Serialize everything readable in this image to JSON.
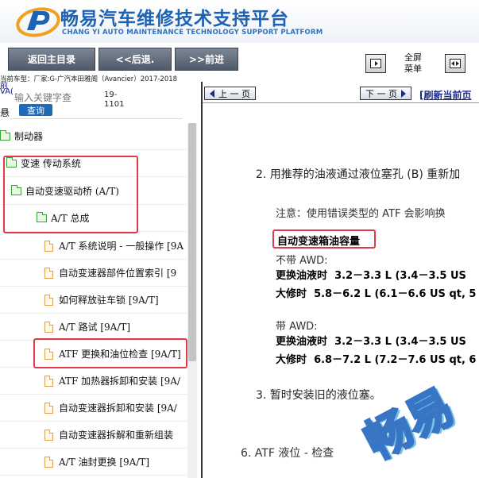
{
  "header": {
    "title_zh": "畅易汽车维修技术支持平台",
    "title_en": "CHANG YI AUTO MAINTENANCE TECHNOLOGY SUPPORT PLATFORM"
  },
  "toolbar": {
    "home_label": "返回主目录",
    "back_label": "<<后退.",
    "forward_label": ">>前进",
    "fullscreen_label_1": "全屏",
    "fullscreen_label_2": "菜单"
  },
  "vehicle_info": "当前车型：厂家:G-广汽本田雅阁（Avancier）2017-2018",
  "left": {
    "edge_1": "前",
    "edge_2": "VA(",
    "search_placeholder": "输入关键字查",
    "search_button": "查询",
    "code": "19-\n1101",
    "edge_item": "悬",
    "tree": [
      {
        "label": "制动器",
        "icon": "folder"
      },
      {
        "label": "变速 传动系统",
        "icon": "folder"
      },
      {
        "label": "自动变速驱动桥 (A/T)",
        "icon": "folder-open"
      },
      {
        "label": "A/T 总成",
        "icon": "folder-open"
      },
      {
        "label": "A/T 系统说明 - 一般操作 [9A",
        "icon": "doc"
      },
      {
        "label": "自动变速器部件位置索引 [9",
        "icon": "doc"
      },
      {
        "label": "如何释放驻车锁 [9A/T]",
        "icon": "doc"
      },
      {
        "label": "A/T 路试 [9A/T]",
        "icon": "doc"
      },
      {
        "label": "ATF 更换和油位检查 [9A/T]",
        "icon": "doc"
      },
      {
        "label": "ATF 加热器拆卸和安装 [9A/",
        "icon": "doc"
      },
      {
        "label": "自动变速器拆卸和安装 [9A/",
        "icon": "doc"
      },
      {
        "label": "自动变速器拆解和重新组装",
        "icon": "doc"
      },
      {
        "label": "A/T 油封更换 [9A/T]",
        "icon": "doc"
      }
    ]
  },
  "right": {
    "prev_page": "上 一 页",
    "next_page": "下 一 页",
    "refresh": "[刷新当前页",
    "doc": {
      "step2": "2.  用推荐的油液通过液位塞孔 (B) 重新加",
      "note": "注意：使用错误类型的 ATF 会影响换",
      "capacity_heading": "自动变速箱油容量",
      "no_awd": "不带 AWD:",
      "no_awd_change_label": "更换油液时",
      "no_awd_change_value": "3.2－3.3 L (3.4－3.5 US",
      "no_awd_overhaul_label": "大修时",
      "no_awd_overhaul_value": "5.8－6.2 L (6.1－6.6 US qt, 5",
      "with_awd": "带 AWD:",
      "awd_change_label": "更换油液时",
      "awd_change_value": "3.2－3.3 L (3.4－3.5 US",
      "awd_overhaul_label": "大修时",
      "awd_overhaul_value": "6.8－7.2 L (7.2－7.6 US qt, 6",
      "step3": "3.  暂时安装旧的液位塞。",
      "section6": "6. ATF 液位 - 检查",
      "watermark": "畅易"
    }
  },
  "colors": {
    "brand_blue": "#1d63b4",
    "highlight_red": "#e03b4a",
    "folder_green": "#3aa33a",
    "doc_orange": "#e0a050"
  }
}
